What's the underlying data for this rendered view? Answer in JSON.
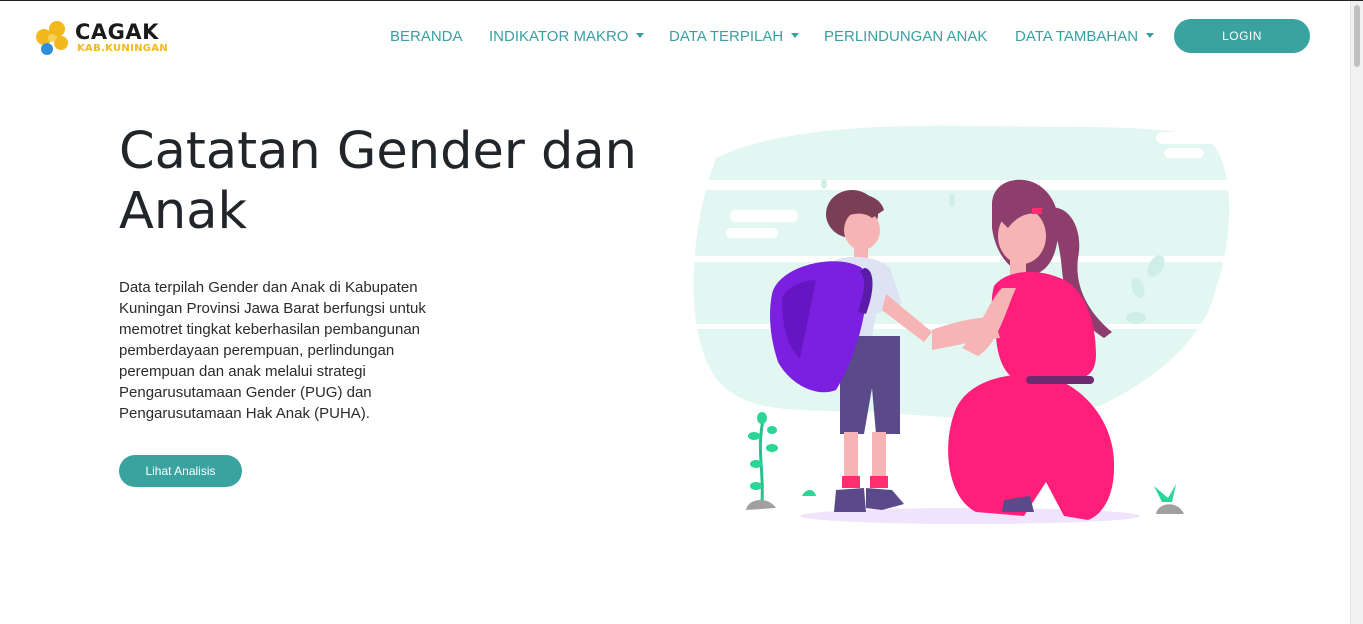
{
  "logo": {
    "brand": "CAGAK",
    "subtitle": "KAB.KUNINGAN"
  },
  "nav": {
    "items": [
      {
        "label": "BERANDA",
        "dropdown": false
      },
      {
        "label": "INDIKATOR MAKRO",
        "dropdown": true
      },
      {
        "label": "DATA TERPILAH",
        "dropdown": true
      },
      {
        "label": "PERLINDUNGAN ANAK",
        "dropdown": false
      },
      {
        "label": "DATA TAMBAHAN",
        "dropdown": true
      }
    ],
    "login_label": "LOGIN"
  },
  "hero": {
    "title": "Catatan Gender dan Anak",
    "description": "Data terpilah Gender dan Anak di Kabupaten Kuningan Provinsi Jawa Barat berfungsi untuk memotret tingkat keberhasilan pembangunan pemberdayaan perempuan, perlindungan perempuan dan anak melalui strategi Pengarusutamaan Gender (PUG) dan Pengarusutamaan Hak Anak (PUHA).",
    "cta_label": "Lihat Analisis"
  },
  "colors": {
    "accent": "#3aa3a0",
    "nav_text": "#3a9fa3",
    "logo_yellow": "#f3b81b",
    "logo_blue": "#2f8fd8",
    "dress_pink": "#ff1f7a",
    "backpack_purple": "#7b1fe0",
    "blob_mint": "#e2f7f2"
  },
  "icons": [
    "logo-flower-icon",
    "chevron-down-icon"
  ]
}
